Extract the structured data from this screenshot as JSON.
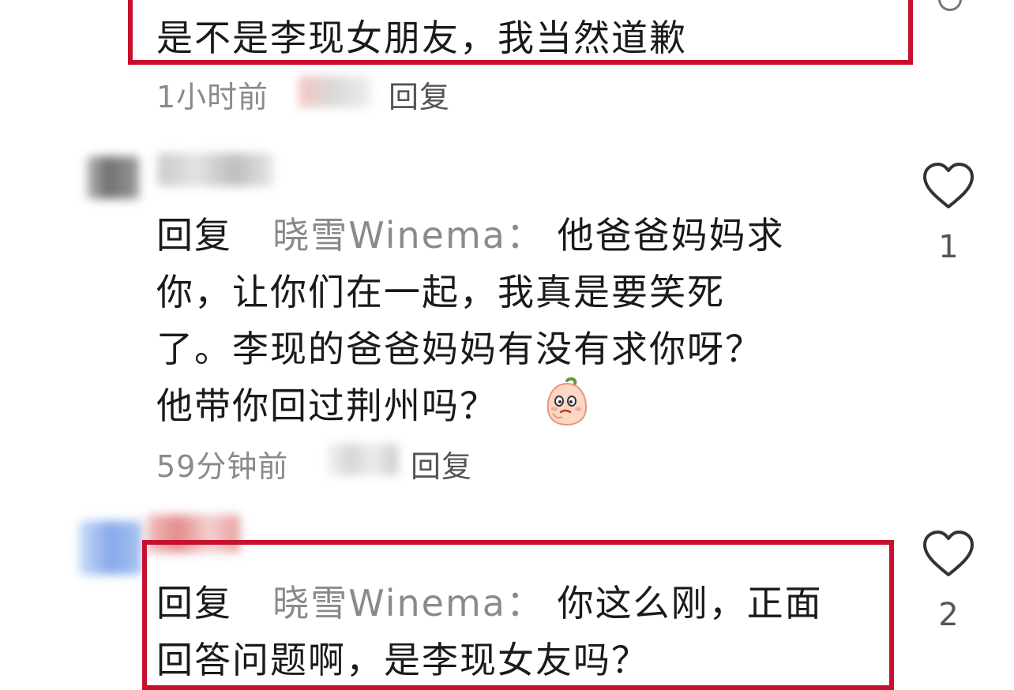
{
  "comments": [
    {
      "body_lines": [
        "是不是李现女朋友，我当然道歉"
      ],
      "time": "1小时前",
      "reply_label": "回复"
    },
    {
      "reply_prefix": "回复",
      "quoted_user": "晓雪Winema：",
      "body_lines": [
        "他爸爸妈妈求",
        "你，让你们在一起，我真是要笑死",
        "了。李现的爸爸妈妈有没有求你呀？",
        "他带你回过荆州吗？"
      ],
      "emoji": "peach-face-emoji",
      "time": "59分钟前",
      "reply_label": "回复",
      "likes": "1",
      "like_icon": "heart-outline-icon"
    },
    {
      "reply_prefix": "回复",
      "quoted_user": "晓雪Winema：",
      "body_lines": [
        "你这么刚，正面",
        "回答问题啊，是李现女友吗？"
      ],
      "likes": "2",
      "like_icon": "heart-outline-icon"
    }
  ],
  "colors": {
    "highlight_border": "#c8102e",
    "meta_text": "#8a8a8a",
    "body_text": "#1a1a1a"
  }
}
